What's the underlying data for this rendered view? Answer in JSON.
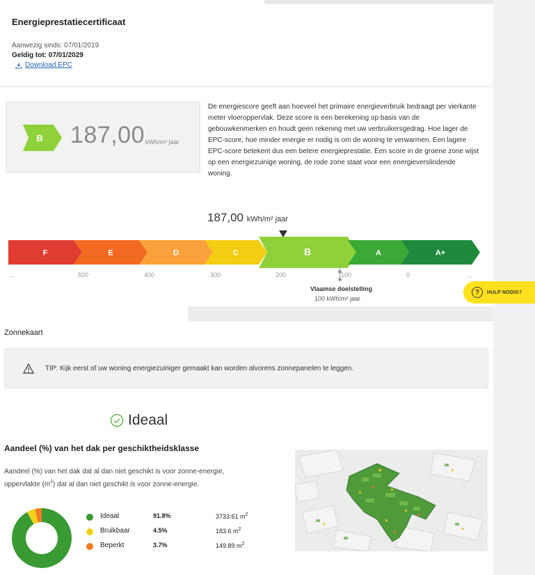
{
  "epc": {
    "title": "Energieprestatiecertificaat",
    "present_since": "Aanwezig sinds: 07/01/2019",
    "valid_until": "Geldig tot: 07/01/2029",
    "download_label": "Download EPC",
    "label": "B",
    "score": "187,00",
    "unit": "kWh/m² jaar",
    "label_color": "#8fd13a",
    "explanation": "De energiescore geeft aan hoeveel het primaire energieverbruik bedraagt per vierkante meter vloeroppervlak. Deze score is een berekening op basis van de gebouwkenmerken en houdt geen rekening met uw verbruikersgedrag. Hoe lager de EPC-score, hoe minder energie er nodig is om de woning te verwarmen. Een lagere EPC-score betekent dus een betere energieprestatie. Een score in de groene zone wijst op een energiezuinige woning, de rode zone staat voor een energieverslindende woning."
  },
  "scale": {
    "score_label": "187,00",
    "score_unit": "kWh/m² jaar",
    "classes": [
      {
        "label": "F",
        "color": "#e03c31"
      },
      {
        "label": "E",
        "color": "#f26a21"
      },
      {
        "label": "D",
        "color": "#f9a13a"
      },
      {
        "label": "C",
        "color": "#f2cd13"
      },
      {
        "label": "B",
        "color": "#8fd13a"
      },
      {
        "label": "A",
        "color": "#3aa935"
      },
      {
        "label": "A+",
        "color": "#1f8a3c"
      }
    ],
    "ticks": [
      "...",
      "500",
      "400",
      "300",
      "200",
      "100",
      "0",
      "..."
    ],
    "goal_title": "Vlaamse doelstelling",
    "goal_value": "100 kWh/m² jaar"
  },
  "help": {
    "label": "HULP NODIG?",
    "color": "#ffe11d"
  },
  "zonnekaart": {
    "title": "Zonnekaart",
    "tip": "TIP: Kijk eerst of uw woning energiezuiniger gemaakt kan worden alvorens zonnepanelen te leggen.",
    "status": "Ideaal",
    "section_title": "Aandeel (%) van het dak per geschiktheidsklasse",
    "description_1": "Aandeel (%) van het dak dat al dan niet geschikt is voor zonne-energie,",
    "description_2a": "oppervlakte (m",
    "description_2b": "2",
    "description_2c": ") dat al dan niet geschikt is voor zonne-energie.",
    "legend": [
      {
        "name": "Ideaal",
        "pct": "91.8%",
        "area": "3733.61 m",
        "sup": "2",
        "color": "#3a9a34",
        "value": 91.8
      },
      {
        "name": "Bruikbaar",
        "pct": "4.5%",
        "area": "183.6 m",
        "sup": "2",
        "color": "#f1d21a",
        "value": 4.5
      },
      {
        "name": "Beperkt",
        "pct": "3.7%",
        "area": "149.89 m",
        "sup": "2",
        "color": "#f27d22",
        "value": 3.7
      }
    ]
  },
  "chart_data": {
    "type": "pie",
    "categories": [
      "Ideaal",
      "Bruikbaar",
      "Beperkt"
    ],
    "values": [
      91.8,
      4.5,
      3.7
    ],
    "title": "Aandeel (%) van het dak per geschiktheidsklasse",
    "xlabel": "",
    "ylabel": ""
  }
}
